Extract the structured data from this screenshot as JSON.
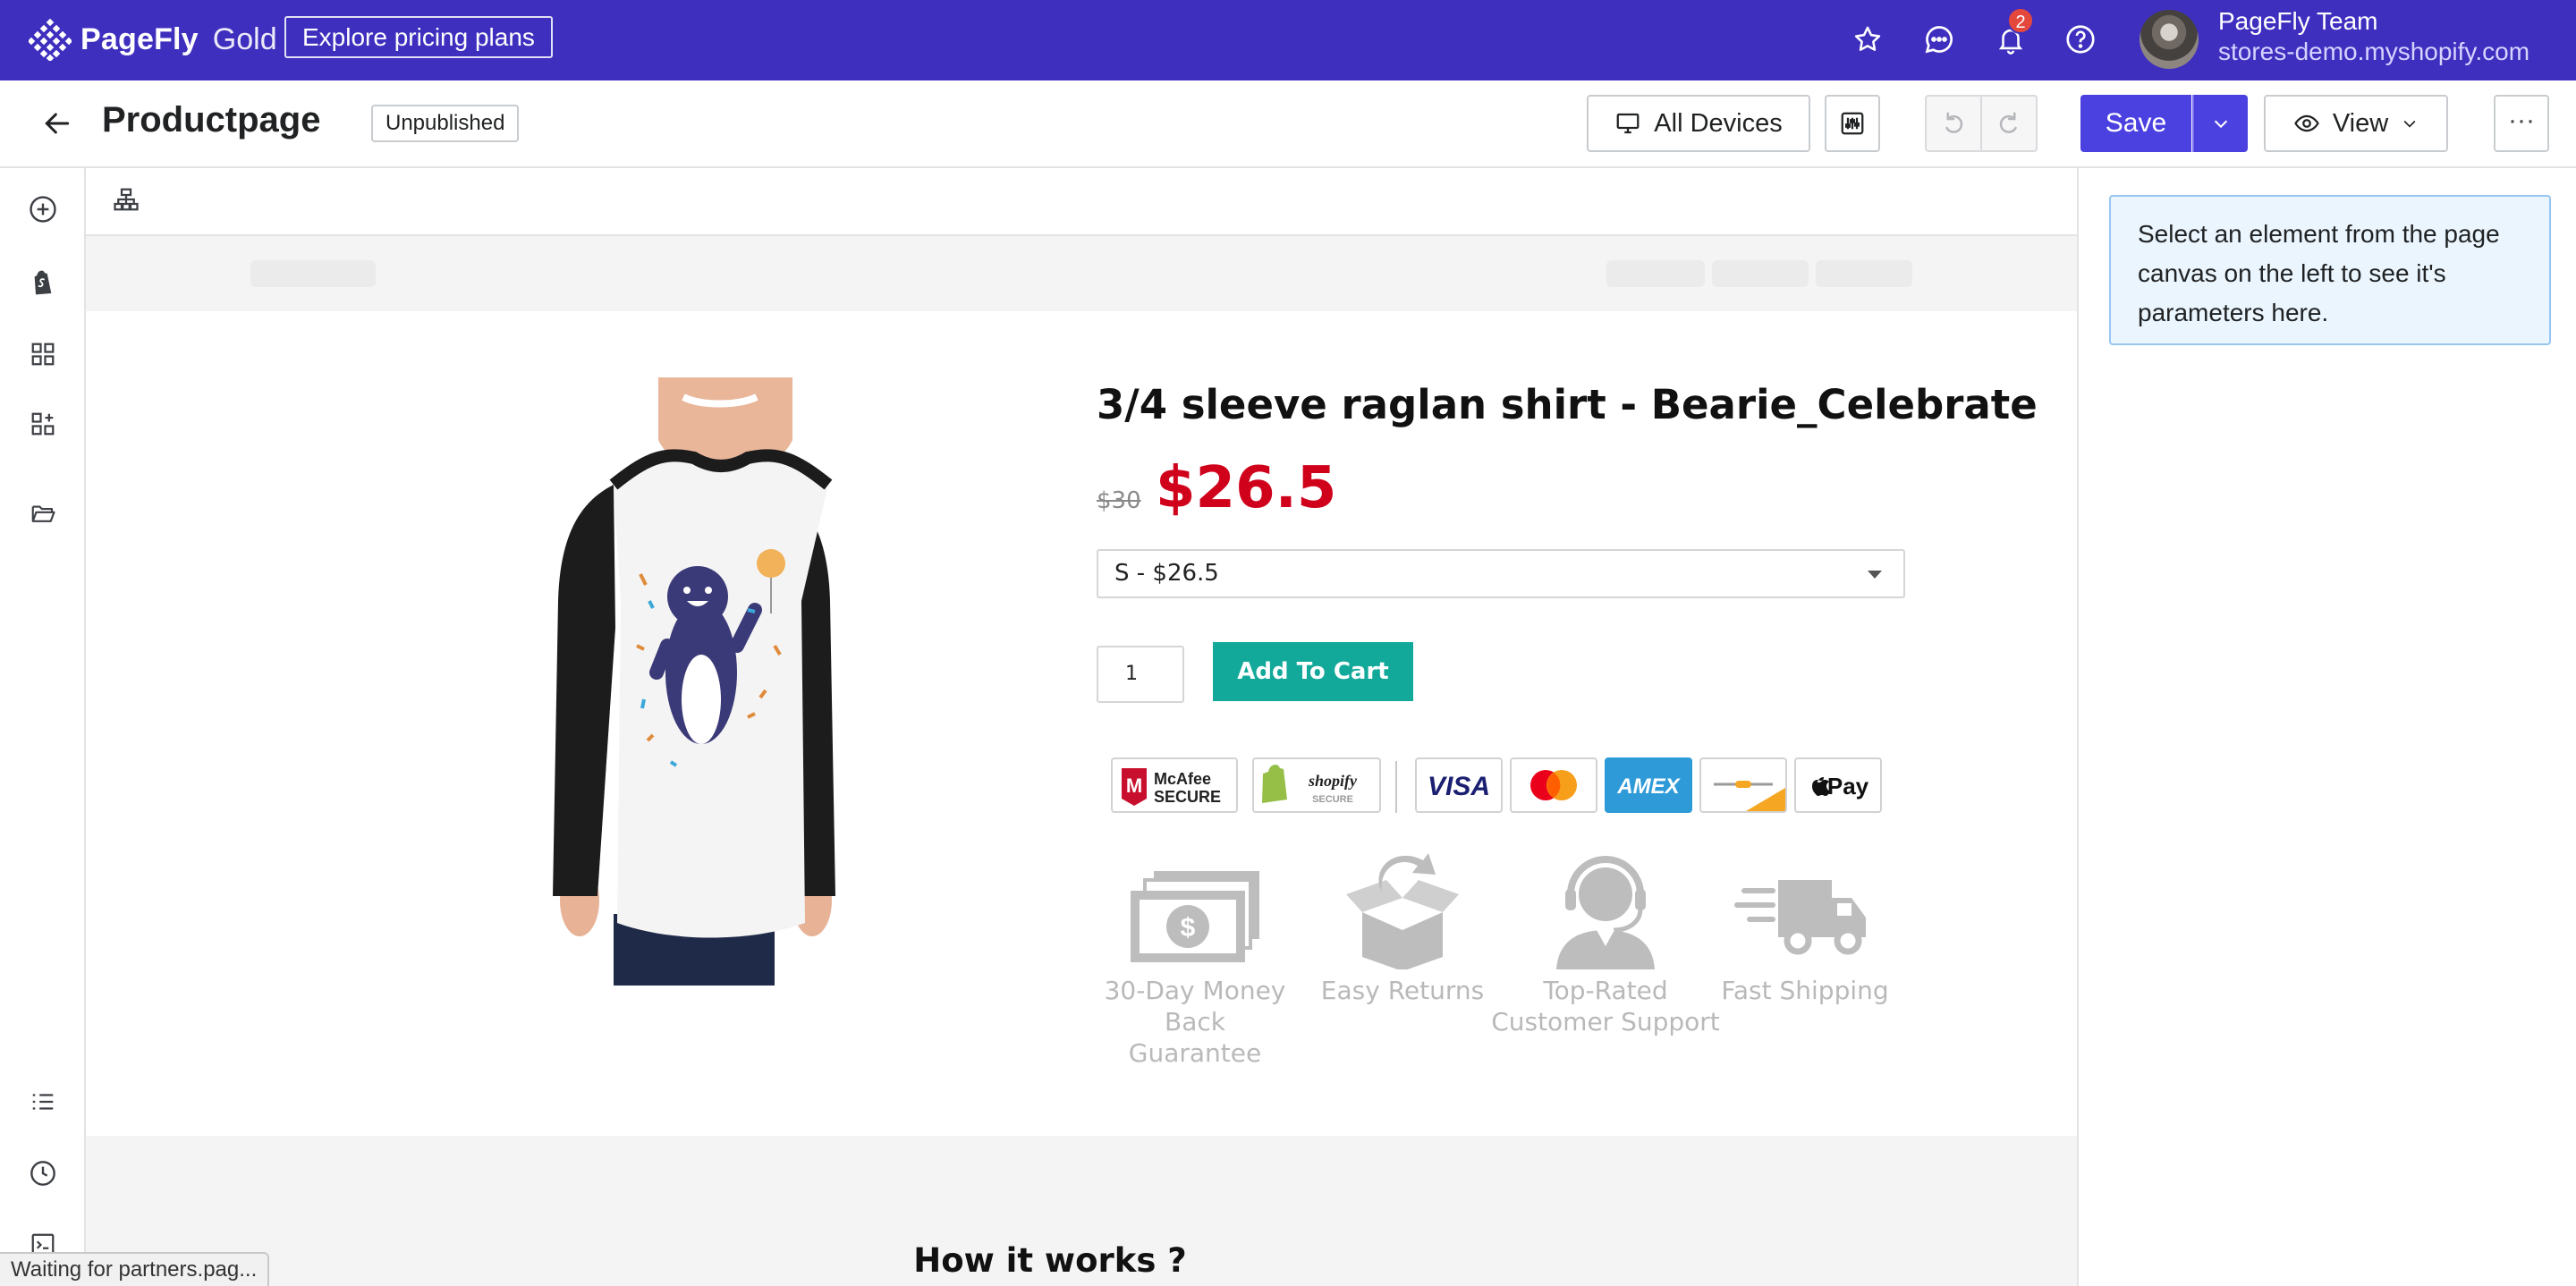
{
  "topbar": {
    "brand": "PageFly",
    "plan": "Gold",
    "pricing_button": "Explore pricing plans",
    "notification_count": "2",
    "account_name": "PageFly Team",
    "account_store": "stores-demo.myshopify.com",
    "accent_color": "#3e2fbf"
  },
  "header": {
    "page_title": "Productpage",
    "status": "Unpublished",
    "devices_label": "All Devices",
    "save_label": "Save",
    "view_label": "View",
    "more_label": "···"
  },
  "canvas": {
    "product": {
      "title": "3/4 sleeve raglan shirt - Bearie_Celebrate",
      "compare_price": "$30",
      "price": "$26.5",
      "variant": "S - $26.5",
      "quantity": "1",
      "add_to_cart": "Add To Cart",
      "price_color": "#d0021b",
      "button_color": "#12a99a"
    },
    "trust_badges": [
      {
        "name": "McAfee SECURE"
      },
      {
        "name": "shopify SECURE"
      },
      {
        "name": "VISA"
      },
      {
        "name": "Mastercard"
      },
      {
        "name": "AMEX"
      },
      {
        "name": "card"
      },
      {
        "name": "Pay"
      }
    ],
    "features": [
      {
        "line1": "30-Day Money",
        "line2": "Back Guarantee"
      },
      {
        "line1": "Easy Returns",
        "line2": ""
      },
      {
        "line1": "Top-Rated",
        "line2": "Customer Support"
      },
      {
        "line1": "Fast Shipping",
        "line2": ""
      }
    ],
    "section_title": "How it works ?"
  },
  "inspector": {
    "message": "Select an element from the page canvas on the left to see it's parameters here."
  },
  "browser_status": "Waiting for partners.pag..."
}
